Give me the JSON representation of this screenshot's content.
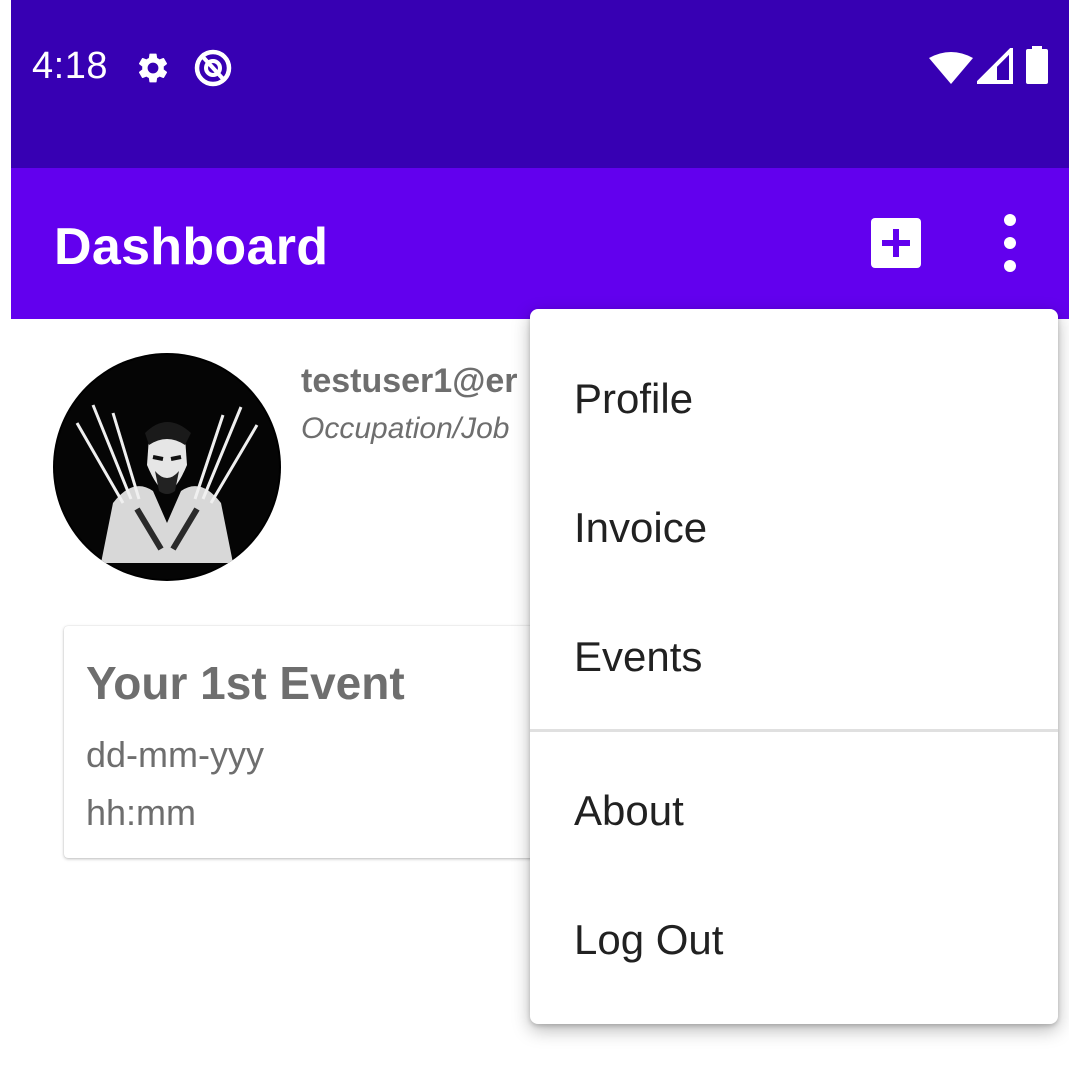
{
  "status_bar": {
    "time": "4:18",
    "icons": [
      "gear-icon",
      "do-not-disturb-icon",
      "wifi-icon",
      "cellular-signal-icon",
      "battery-icon"
    ],
    "background_color": "#3700b3"
  },
  "app_bar": {
    "title": "Dashboard",
    "actions": [
      "add-box-icon",
      "more-vert-icon"
    ],
    "background_color": "#6200ee"
  },
  "profile": {
    "email": "testuser1@er",
    "occupation": "Occupation/Job",
    "avatar": "profile-photo"
  },
  "event_card": {
    "title": "Your 1st Event",
    "date": "dd-mm-yyy",
    "time": "hh:mm"
  },
  "overflow_menu": {
    "items": [
      {
        "label": "Profile"
      },
      {
        "label": "Invoice"
      },
      {
        "label": "Events"
      },
      {
        "label": "About"
      },
      {
        "label": "Log Out"
      }
    ]
  }
}
